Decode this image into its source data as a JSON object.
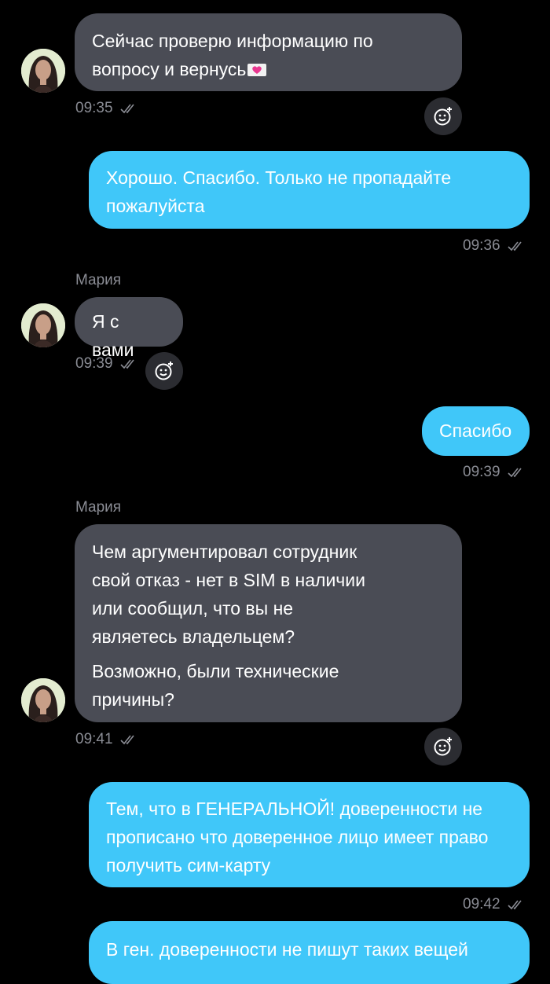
{
  "chat": {
    "messages": [
      {
        "sender": "",
        "text": [
          "Сейчас проверю информацию по",
          "вопросу и вернусь"
        ],
        "emoji": "heart-envelope",
        "time": "09:35",
        "direction": "incoming"
      },
      {
        "text": [
          "Хорошо. Спасибо. Только не пропадайте",
          "пожалуйста"
        ],
        "time": "09:36",
        "direction": "outgoing"
      },
      {
        "sender": "Мария",
        "text": [
          "Я с вами"
        ],
        "time": "09:39",
        "direction": "incoming"
      },
      {
        "text": [
          "Спасибо"
        ],
        "time": "09:39",
        "direction": "outgoing"
      },
      {
        "sender": "Мария",
        "paragraphs": [
          "Чем аргументировал сотрудник свой отказ - нет в SIM в наличии или сообщил, что вы не являетесь владельцем?",
          "Возможно, были технические причины?"
        ],
        "time": "09:41",
        "direction": "incoming"
      },
      {
        "text": [
          "Тем, что в ГЕНЕРАЛЬНОЙ! доверенности не",
          "прописано что доверенное лицо имеет право",
          "получить сим-карту"
        ],
        "time": "09:42",
        "direction": "outgoing"
      },
      {
        "text": [
          "В ген. доверенности не пишут таких вещей"
        ],
        "direction": "outgoing"
      }
    ]
  },
  "colors": {
    "background": "#000000",
    "incoming_bubble": "#4a4c55",
    "outgoing_bubble": "#40c7f9",
    "timestamp": "#8a8c94"
  },
  "icons": {
    "read_receipt": "double-check-icon",
    "reaction": "smile-plus-icon",
    "avatar": "agent-avatar"
  }
}
